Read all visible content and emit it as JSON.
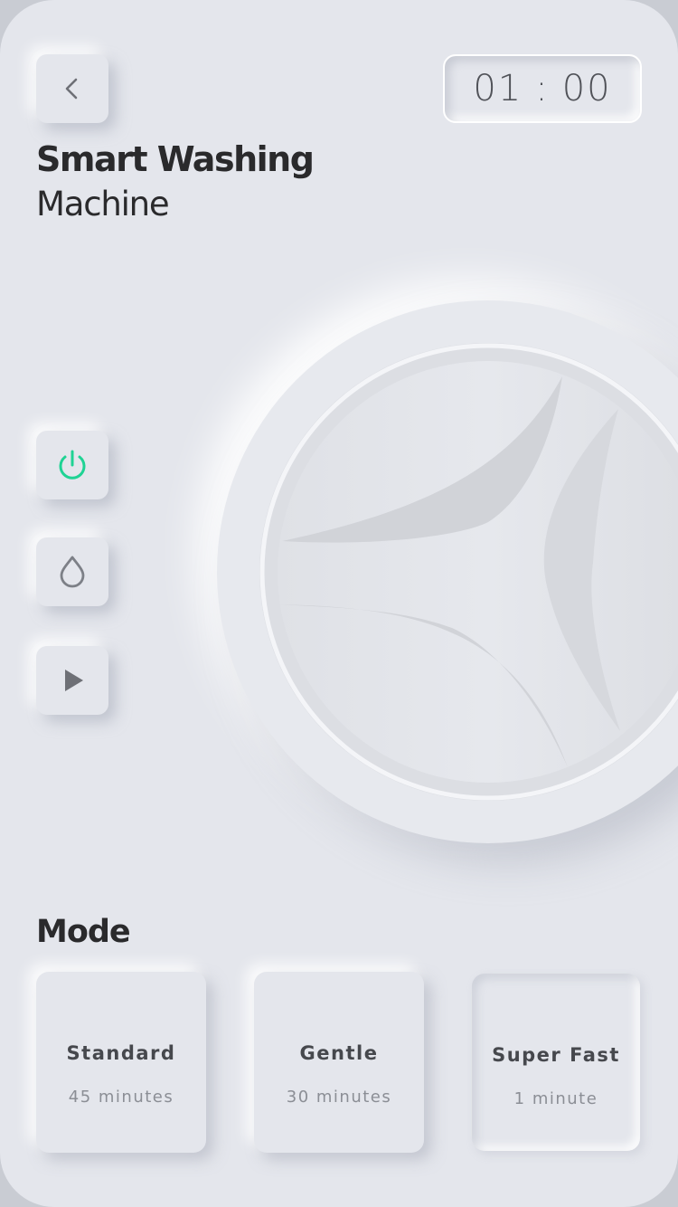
{
  "header": {
    "back_icon": "chevron-left-icon",
    "timer": {
      "minutes": "01",
      "separator": ":",
      "seconds": "00"
    }
  },
  "title": {
    "line1": "Smart Washing",
    "line2": "Machine"
  },
  "controls": [
    {
      "name": "power",
      "icon": "power-icon",
      "active": true,
      "color": "#1fd394"
    },
    {
      "name": "water",
      "icon": "water-drop-icon",
      "active": false,
      "color": "#7d8087"
    },
    {
      "name": "start",
      "icon": "play-icon",
      "active": false,
      "color": "#6e7076"
    }
  ],
  "mode": {
    "title": "Mode",
    "items": [
      {
        "name": "Standard",
        "duration": "45 minutes"
      },
      {
        "name": "Gentle",
        "duration": "30 minutes"
      },
      {
        "name": "Super Fast",
        "duration": "1 minute",
        "selected": true
      }
    ]
  },
  "colors": {
    "background": "#e4e6ec",
    "accent": "#1fd394",
    "text": "#2a2a2c"
  }
}
